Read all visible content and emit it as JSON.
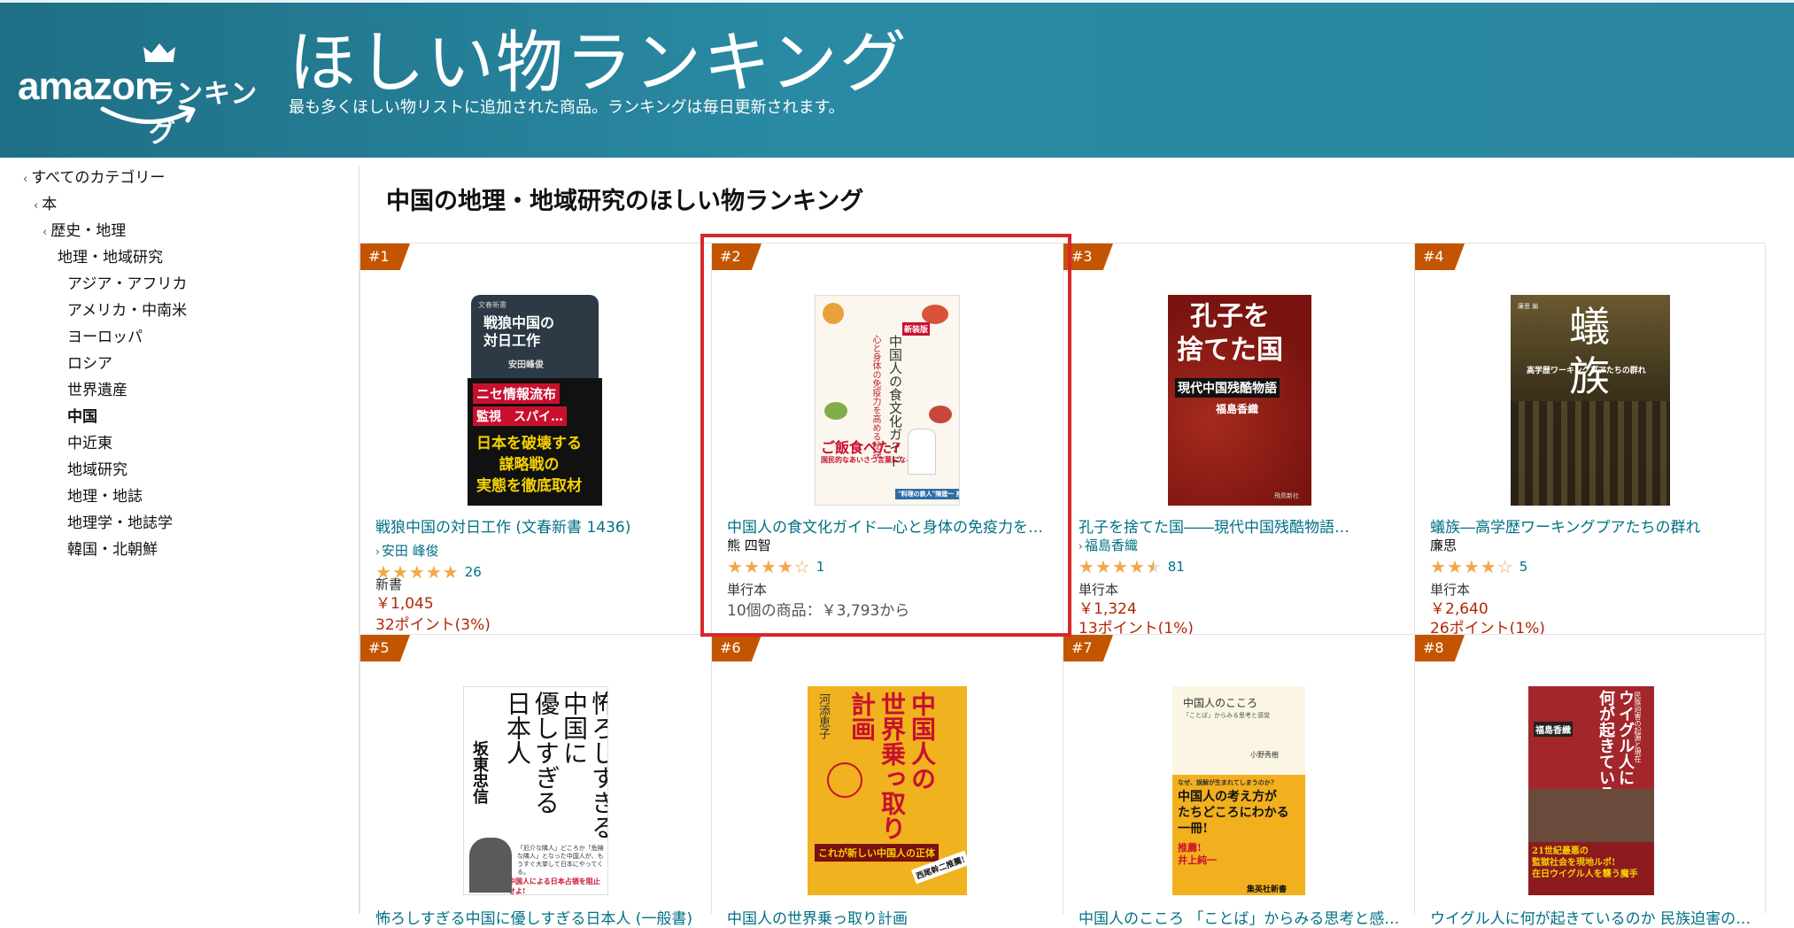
{
  "banner": {
    "logo_wordmark": "amazon",
    "logo_sub": "ランキング",
    "title": "ほしい物ランキング",
    "subtitle": "最も多くほしい物リストに追加された商品。ランキングは毎日更新されます。"
  },
  "sidebar": {
    "items": [
      {
        "label": "すべてのカテゴリー",
        "chevron": "‹"
      },
      {
        "label": "本",
        "chevron": "‹"
      },
      {
        "label": "歴史・地理",
        "chevron": "‹"
      },
      {
        "label": "地理・地域研究"
      },
      {
        "label": "アジア・アフリカ"
      },
      {
        "label": "アメリカ・中南米"
      },
      {
        "label": "ヨーロッパ"
      },
      {
        "label": "ロシア"
      },
      {
        "label": "世界遺産"
      },
      {
        "label": "中国"
      },
      {
        "label": "中近東"
      },
      {
        "label": "地域研究"
      },
      {
        "label": "地理・地誌"
      },
      {
        "label": "地理学・地誌学"
      },
      {
        "label": "韓国・北朝鮮"
      }
    ]
  },
  "heading": "中国の地理・地域研究のほしい物ランキング",
  "products": [
    {
      "rank": "#1",
      "title": "戦狼中国の対日工作 (文春新書 1436)",
      "author": "安田 峰俊",
      "rating": 5,
      "reviews": "26",
      "format": "新書",
      "price": "￥1,045",
      "points": "32ポイント(3%)",
      "cover": {
        "top": "戦狼中国の\n対日工作",
        "author": "安田峰俊",
        "band1": "ニセ情報流布",
        "band2": "監視　スパイ…",
        "band3": "日本を破壊する\n謀略戦の\n実態を徹底取材",
        "publisher": "文春新書"
      }
    },
    {
      "rank": "#2",
      "title": "中国人の食文化ガイド―心と身体の免疫力を…",
      "author": "熊 四智",
      "rating": 4,
      "reviews": "1",
      "format": "単行本",
      "offers": "10個の商品：￥3,793から",
      "cover": {
        "label": "新装版",
        "title": "中国人の食文化ガイド",
        "sub": "心と身体の免疫力を高める秘訣",
        "catch": "ご飯食べた?",
        "catch2": "国民的なあいさつ言葉になる中国人",
        "badge": "\"料理の鉄人\"陳建一 推薦!"
      }
    },
    {
      "rank": "#3",
      "title": "孔子を捨てた国――現代中国残酷物語…",
      "author": "福島香織",
      "rating": 4.5,
      "reviews": "81",
      "format": "単行本",
      "price": "￥1,324",
      "points": "13ポイント(1%)",
      "cover": {
        "title": "孔子を\n捨てた国",
        "sub": "現代中国残酷物語",
        "author": "福島香織",
        "publisher": "飛鳥新社"
      }
    },
    {
      "rank": "#4",
      "title": "蟻族―高学歴ワーキングプアたちの群れ",
      "author": "廉思",
      "rating": 4,
      "reviews": "5",
      "format": "単行本",
      "price": "￥2,640",
      "points": "26ポイント(1%)",
      "cover": {
        "title": "蟻\n族",
        "sub": "高学歴ワーキングプアたちの群れ",
        "author": "廉思 編"
      }
    },
    {
      "rank": "#5",
      "title": "怖ろしすぎる中国に優しすぎる日本人 (一般書)",
      "cover": {
        "title": "怖ろしすぎる\n中国に\n優しすぎる\n日本人",
        "author": "坂東忠信",
        "note": "「厄介な隣人」どころか「危険な隣人」となった中国人が、もうすぐ大挙して日本にやってくる。",
        "red": "中国人による日本占領を阻止せよ!"
      }
    },
    {
      "rank": "#6",
      "title": "中国人の世界乗っ取り計画",
      "cover": {
        "title": "中国人の\n世界乗っ取り\n計画",
        "author": "河添恵子",
        "band": "これが新しい中国人の正体",
        "tag": "西尾幹二推薦!"
      }
    },
    {
      "rank": "#7",
      "title": "中国人のこころ 「ことば」からみる思考と感…",
      "cover": {
        "title": "中国人のこころ",
        "sub": "「ことば」からみる思考と感覚",
        "author": "小野秀樹",
        "q": "なぜ、誤解が生まれてしまうのか?",
        "main": "中国人の考え方が\nたちどころにわかる\n一冊!",
        "rec": "推薦!\n井上純一",
        "publisher": "集英社新書"
      }
    },
    {
      "rank": "#8",
      "title": "ウイグル人に何が起きているのか 民族迫害の…",
      "cover": {
        "title": "ウイグル人に\n何が起きているのか",
        "sub": "民族迫害の起源と現在",
        "author": "福島香織",
        "band": "21世紀最悪の\n監獄社会を現地ルポ!\n在日ウイグル人を襲う魔手"
      }
    }
  ],
  "colors": {
    "banner": "#2a8aa4",
    "badge": "#c45500",
    "link": "#007185",
    "price": "#b12704",
    "star": "#f3a847",
    "highlight": "#d9262c"
  }
}
